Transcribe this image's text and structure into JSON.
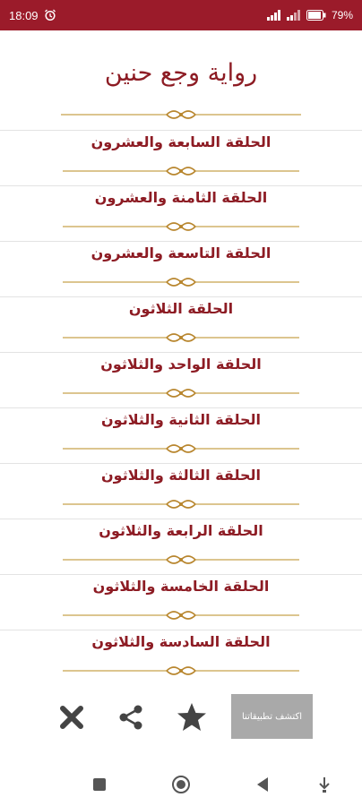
{
  "status_bar": {
    "time": "18:09",
    "battery": "79"
  },
  "title": "رواية وجع حنين",
  "episodes": [
    {
      "label": "الحلقة السابعة والعشرون"
    },
    {
      "label": "الحلقة الثامنة والعشرون"
    },
    {
      "label": "الحلقة التاسعة والعشرون"
    },
    {
      "label": "الحلقة الثلاثون"
    },
    {
      "label": "الحلقة الواحد والثلاثون"
    },
    {
      "label": "الحلقة الثانية والثلاثون"
    },
    {
      "label": "الحلقة الثالثة والثلاثون"
    },
    {
      "label": "الحلقة الرابعة والثلاثون"
    },
    {
      "label": "الحلقة الخامسة والثلاثون"
    },
    {
      "label": "الحلقة السادسة والثلاثون"
    }
  ],
  "actions": {
    "discover_label": "اكتشف تطبيقاتنا",
    "icons": [
      "close-icon",
      "share-icon",
      "star-icon"
    ]
  },
  "colors": {
    "status_bar": "#9b1b2a",
    "title_text": "#8d1c24",
    "ornament_gold": "#c8a24c",
    "discover_bg": "#a9a9a9",
    "icons": "#444444"
  }
}
